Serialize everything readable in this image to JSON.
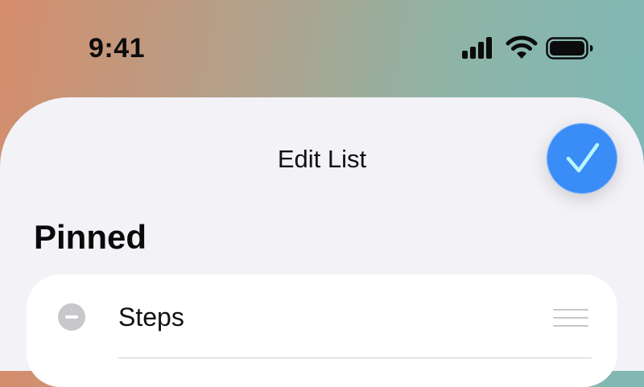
{
  "status_bar": {
    "time": "9:41",
    "signal_icon": "cellular-signal-icon",
    "wifi_icon": "wifi-icon",
    "battery_icon": "battery-full-icon"
  },
  "sheet": {
    "title": "Edit List",
    "done_icon": "checkmark-icon",
    "accent_color": "#3a8cf7"
  },
  "sections": [
    {
      "header": "Pinned",
      "items": [
        {
          "label": "Steps",
          "remove_icon": "minus-circle-icon",
          "reorder_icon": "drag-handle-icon"
        }
      ]
    }
  ]
}
